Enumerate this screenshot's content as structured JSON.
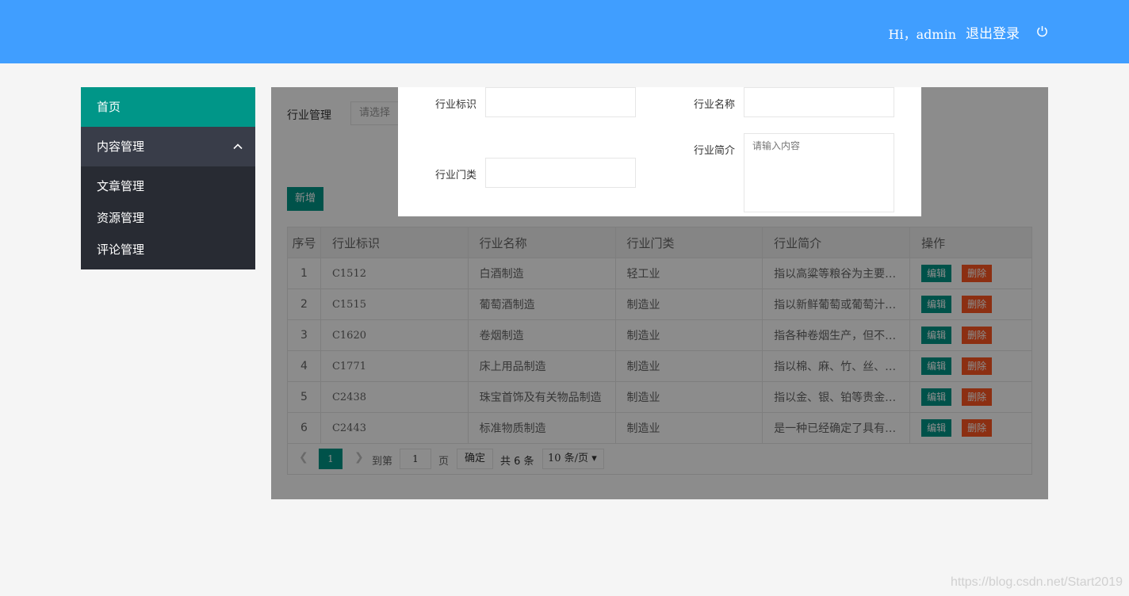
{
  "header": {
    "greeting": "Hi，admin",
    "logout_label": "退出登录",
    "bg_color": "#409eff",
    "logout_icon": "power-icon"
  },
  "sidebar": {
    "home_label": "首页",
    "group_label": "内容管理",
    "group_icon": "chevron-up-icon",
    "items": [
      {
        "label": "文章管理"
      },
      {
        "label": "资源管理"
      },
      {
        "label": "评论管理"
      }
    ]
  },
  "filter": {
    "label": "行业管理",
    "select_placeholder": "请选择"
  },
  "toolbar": {
    "add_label": "新增"
  },
  "table": {
    "headers": [
      "序号",
      "行业标识",
      "行业名称",
      "行业门类",
      "行业简介",
      "操作"
    ],
    "rows": [
      {
        "idx": "1",
        "code": "C1512",
        "name": "白酒制造",
        "category": "轻工业",
        "intro": "指以高粱等粮谷为主要…"
      },
      {
        "idx": "2",
        "code": "C1515",
        "name": "葡萄酒制造",
        "category": "制造业",
        "intro": "指以新鲜葡萄或葡萄汁…"
      },
      {
        "idx": "3",
        "code": "C1620",
        "name": "卷烟制造",
        "category": "制造业",
        "intro": "指各种卷烟生产，但不…"
      },
      {
        "idx": "4",
        "code": "C1771",
        "name": "床上用品制造",
        "category": "制造业",
        "intro": "指以棉、麻、竹、丝、…"
      },
      {
        "idx": "5",
        "code": "C2438",
        "name": "珠宝首饰及有关物品制造",
        "category": "制造业",
        "intro": "指以金、银、铂等贵金…"
      },
      {
        "idx": "6",
        "code": "C2443",
        "name": "标准物质制造",
        "category": "制造业",
        "intro": "是一种已经确定了具有…"
      }
    ],
    "edit_label": "编辑",
    "delete_label": "删除"
  },
  "pager": {
    "prev_icon": "chevron-left-icon",
    "current": "1",
    "next_icon": "chevron-right-icon",
    "goto_label": "到第",
    "goto_value": "1",
    "page_label": "页",
    "confirm_label": "确定",
    "total_label": "共 6 条",
    "page_size": "10 条/页"
  },
  "modal": {
    "code_label": "行业标识",
    "name_label": "行业名称",
    "category_label": "行业门类",
    "intro_label": "行业简介",
    "intro_placeholder": "请输入内容"
  },
  "watermark": "https://blog.csdn.net/Start2019"
}
